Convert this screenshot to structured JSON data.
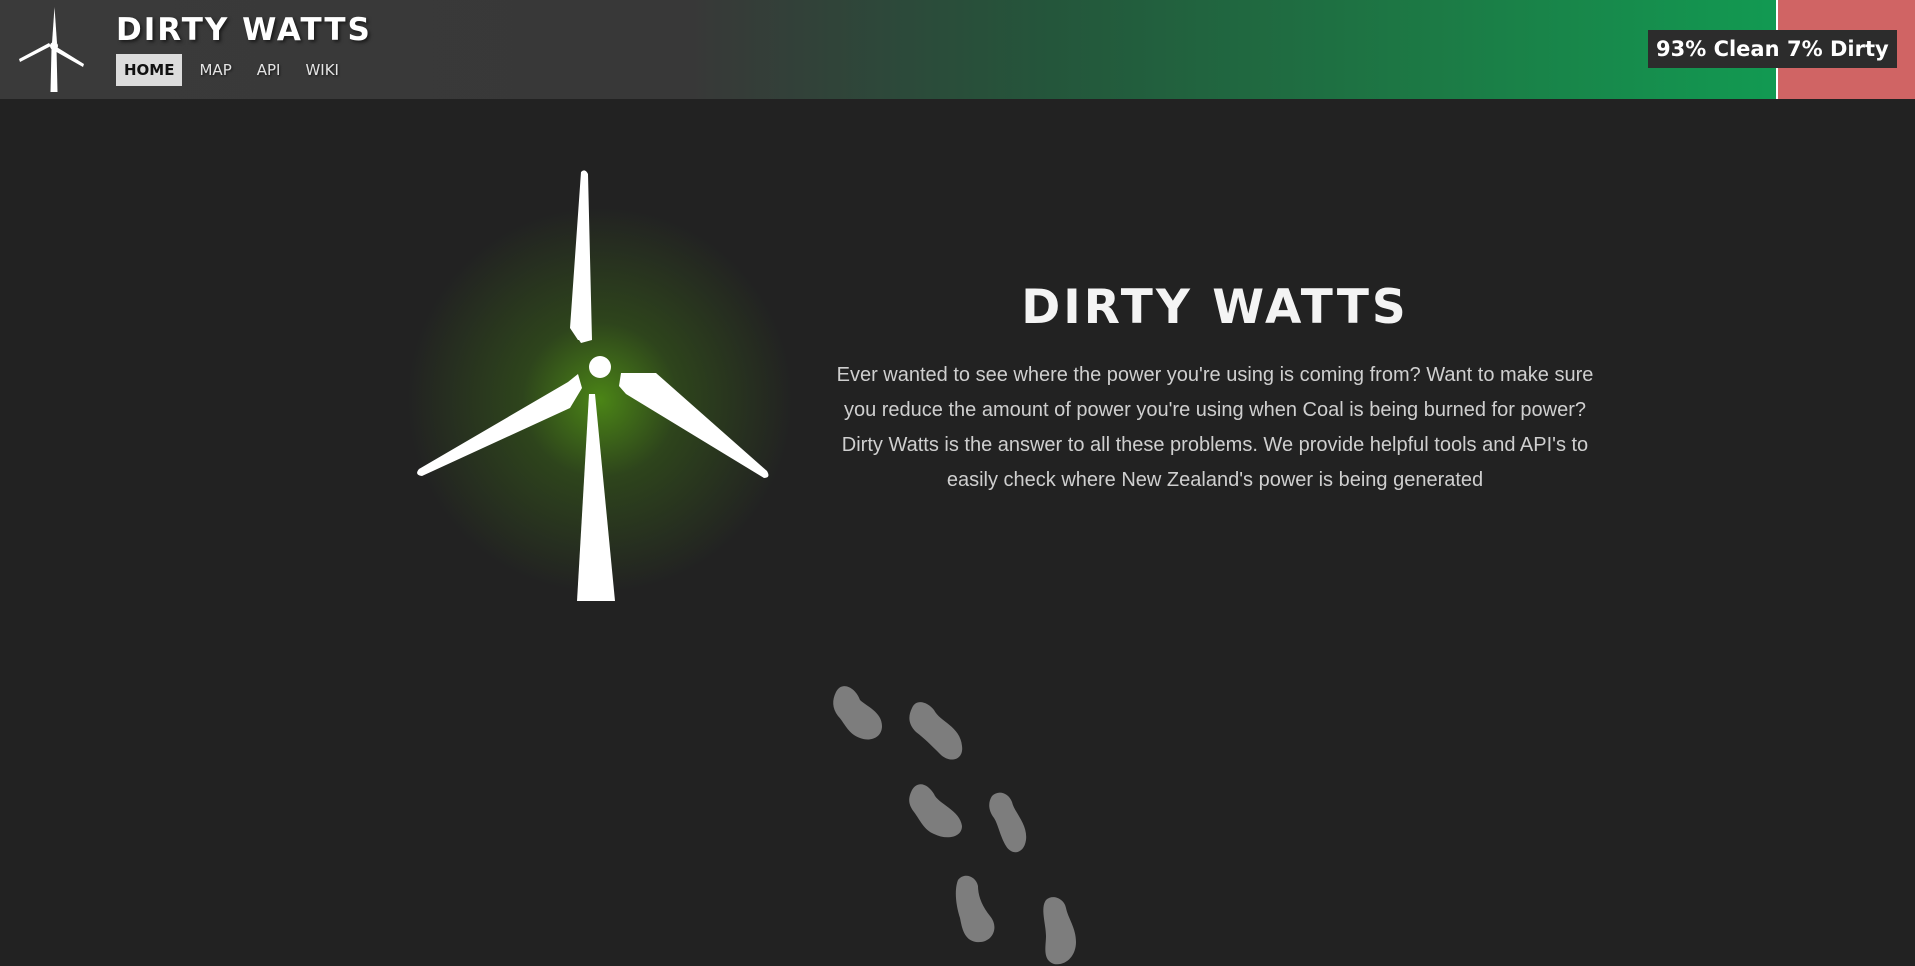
{
  "header": {
    "brand": "DIRTY WATTS",
    "nav": [
      {
        "label": "HOME",
        "active": true
      },
      {
        "label": "MAP",
        "active": false
      },
      {
        "label": "API",
        "active": false
      },
      {
        "label": "WIKI",
        "active": false
      }
    ],
    "clean_label": "93% Clean",
    "dirty_label": "7% Dirty",
    "clean_percent": 93,
    "dirty_percent": 7
  },
  "hero": {
    "title": "DIRTY WATTS",
    "description": "Ever wanted to see where the power you're using is coming from? Want to make sure you reduce the amount of power you're using when Coal is being burned for power? Dirty Watts is the answer to all these problems. We provide helpful tools and API's to easily check where New Zealand's power is being generated"
  },
  "icons": {
    "logo": "wind-turbine-icon",
    "hero": "wind-turbine-icon",
    "footer": "footsteps-icon"
  },
  "colors": {
    "background": "#222222",
    "clean": "#129a52",
    "dirty": "#d06464",
    "glow": "#52961a",
    "footsteps": "#7d7d7d"
  }
}
